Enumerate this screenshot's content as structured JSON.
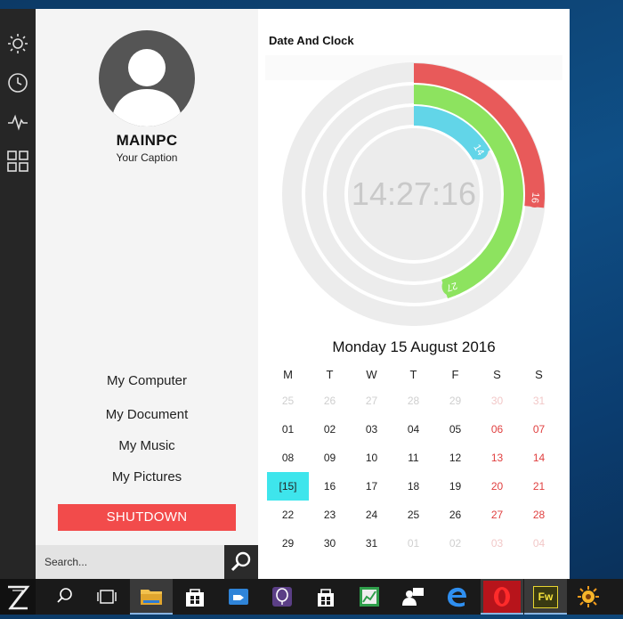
{
  "rail": {
    "icons": [
      "sun-icon",
      "clock-icon",
      "activity-pulse-icon",
      "grid-tiles-icon"
    ]
  },
  "user": {
    "name": "MAINPC",
    "caption": "Your Caption"
  },
  "menu": {
    "items": [
      "My Computer",
      "My Document",
      "My Music",
      "My Pictures"
    ],
    "shutdown_label": "SHUTDOWN"
  },
  "search": {
    "placeholder": "Search..."
  },
  "clock": {
    "title": "Date And Clock",
    "time": "14:27:16",
    "hours": 14,
    "minutes": 27,
    "seconds": 16,
    "colors": {
      "seconds": "#e85a5a",
      "minutes": "#8de35f",
      "hours": "#62d5e8",
      "track": "#ececec"
    }
  },
  "calendar": {
    "heading": "Monday 15 August 2016",
    "weekdays": [
      "M",
      "T",
      "W",
      "T",
      "F",
      "S",
      "S"
    ],
    "rows": [
      [
        "25",
        "26",
        "27",
        "28",
        "29",
        "30",
        "31"
      ],
      [
        "01",
        "02",
        "03",
        "04",
        "05",
        "06",
        "07"
      ],
      [
        "08",
        "09",
        "10",
        "11",
        "12",
        "13",
        "14"
      ],
      [
        "[15]",
        "16",
        "17",
        "18",
        "19",
        "20",
        "21"
      ],
      [
        "22",
        "23",
        "24",
        "25",
        "26",
        "27",
        "28"
      ],
      [
        "29",
        "30",
        "31",
        "01",
        "02",
        "03",
        "04"
      ]
    ],
    "today_color": "#3ee5ec",
    "weekend_color": "#e04040"
  },
  "taskbar": {
    "icons": [
      "start-z-icon",
      "search-icon",
      "task-view-icon",
      "file-explorer-icon",
      "store-icon",
      "tag-app-icon",
      "balloon-app-icon",
      "shopping-bag-icon",
      "spreadsheet-icon",
      "people-icon",
      "edge-icon",
      "opera-icon",
      "fireworks-icon",
      "xnview-icon"
    ],
    "fireworks_label": "Fw"
  }
}
